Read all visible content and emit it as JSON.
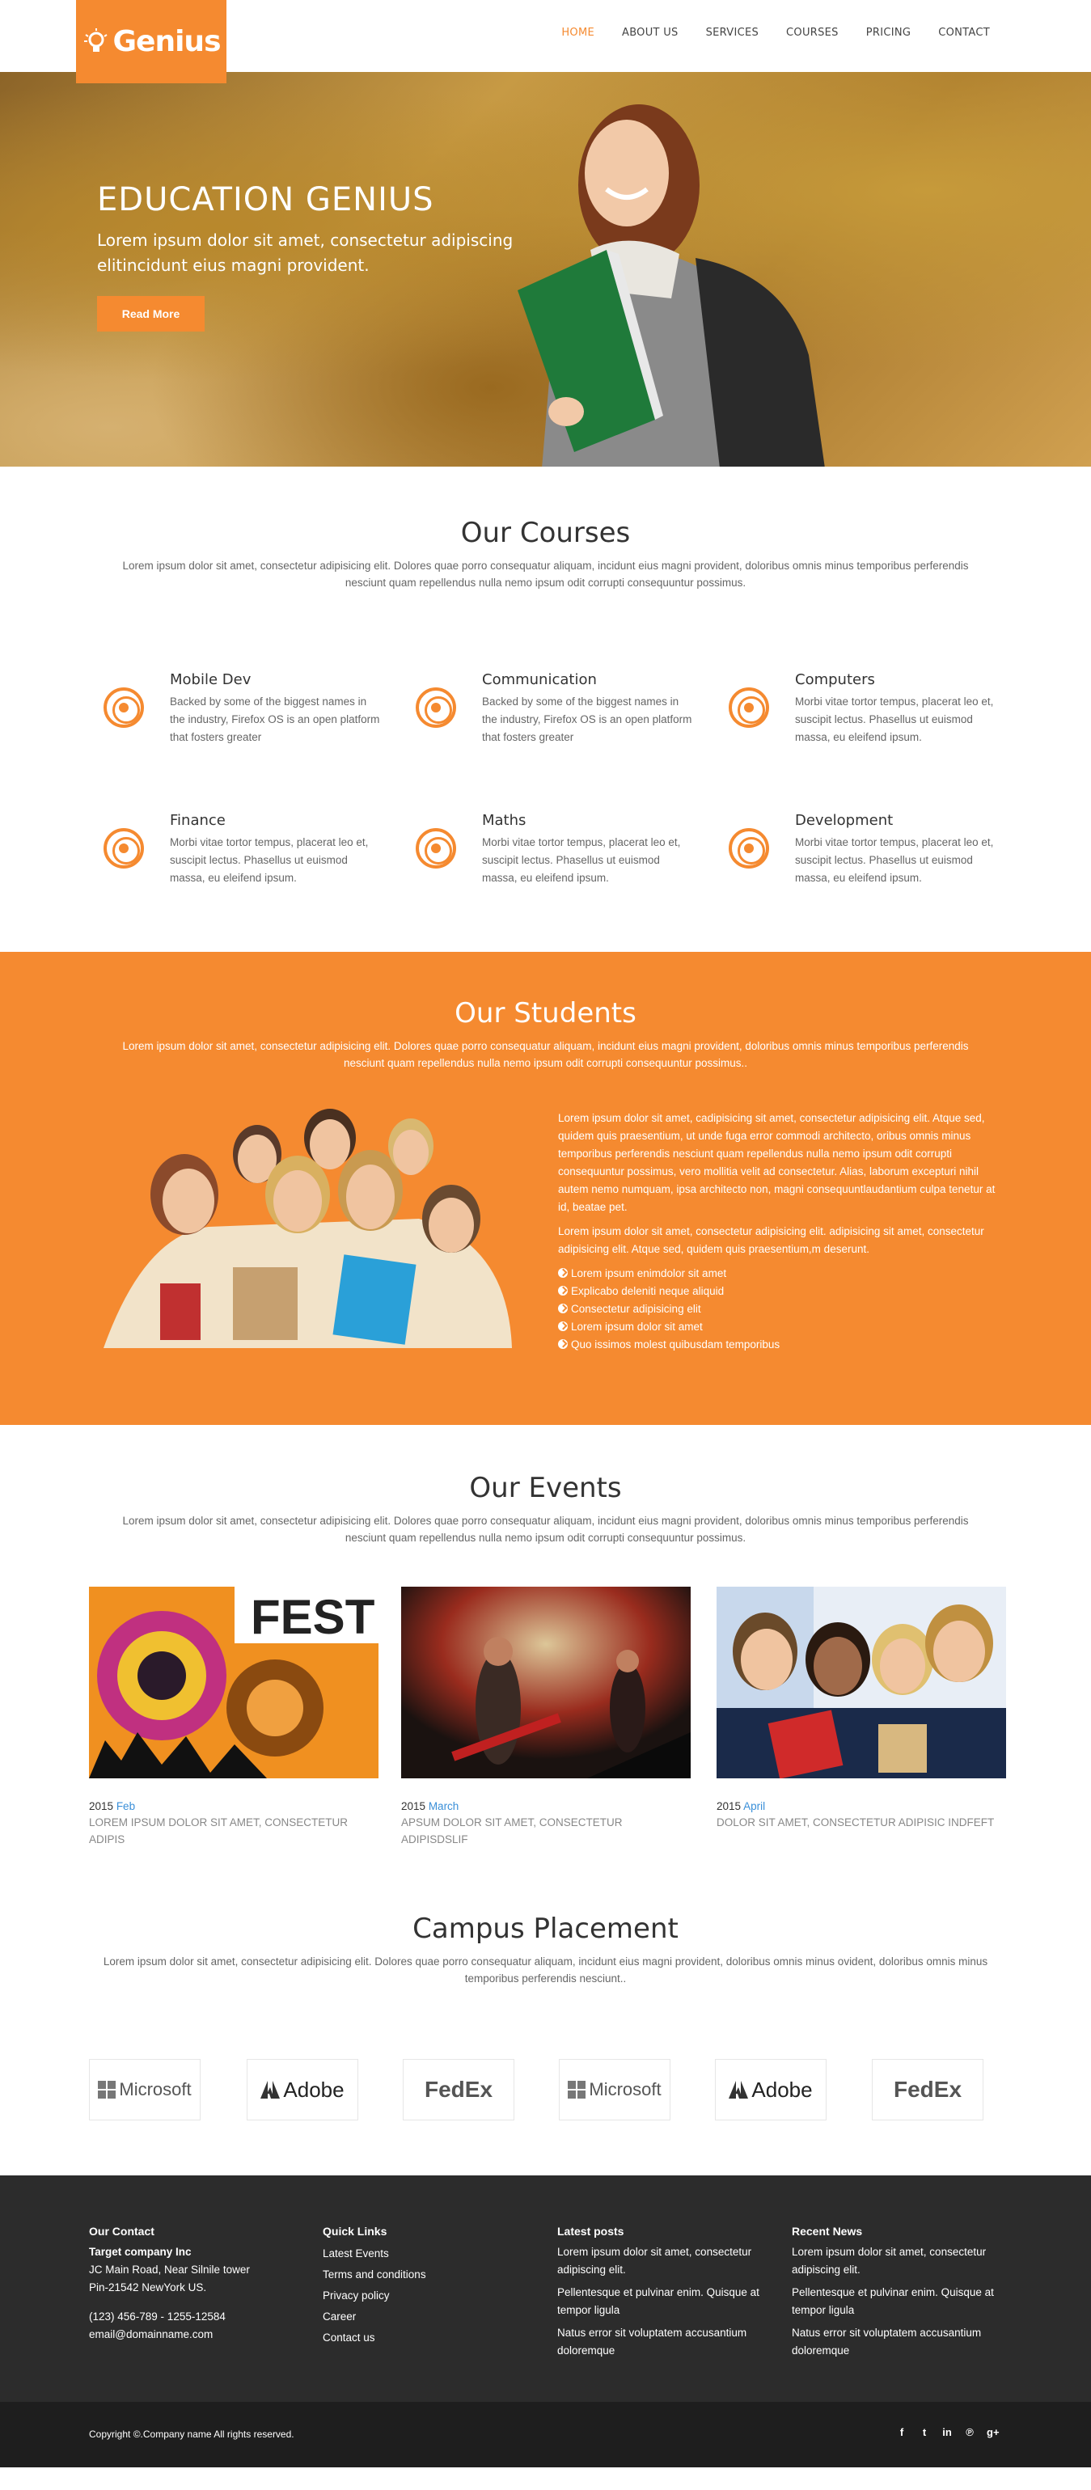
{
  "brand": {
    "name": "Genius",
    "color": "#f58a30"
  },
  "nav": {
    "items": [
      "HOME",
      "ABOUT US",
      "SERVICES",
      "COURSES",
      "PRICING",
      "CONTACT"
    ],
    "active": "HOME"
  },
  "hero": {
    "title": "EDUCATION GENIUS",
    "subtitle": "Lorem ipsum dolor sit amet, consectetur adipiscing elitincidunt eius magni provident.",
    "button": "Read More"
  },
  "courses": {
    "title": "Our Courses",
    "desc": "Lorem ipsum dolor sit amet, consectetur adipisicing elit. Dolores quae porro consequatur aliquam, incidunt eius magni provident, doloribus omnis minus temporibus perferendis nesciunt quam repellendus nulla nemo ipsum odit corrupti consequuntur possimus.",
    "items": [
      {
        "title": "Mobile Dev",
        "text": "Backed by some of the biggest names in the industry, Firefox OS is an open platform that fosters greater"
      },
      {
        "title": "Communication",
        "text": "Backed by some of the biggest names in the industry, Firefox OS is an open platform that fosters greater"
      },
      {
        "title": "Computers",
        "text": "Morbi vitae tortor tempus, placerat leo et, suscipit lectus. Phasellus ut euismod massa, eu eleifend ipsum."
      },
      {
        "title": "Finance",
        "text": "Morbi vitae tortor tempus, placerat leo et, suscipit lectus. Phasellus ut euismod massa, eu eleifend ipsum."
      },
      {
        "title": "Maths",
        "text": "Morbi vitae tortor tempus, placerat leo et, suscipit lectus. Phasellus ut euismod massa, eu eleifend ipsum."
      },
      {
        "title": "Development",
        "text": "Morbi vitae tortor tempus, placerat leo et, suscipit lectus. Phasellus ut euismod massa, eu eleifend ipsum."
      }
    ]
  },
  "students": {
    "title": "Our Students",
    "desc": "Lorem ipsum dolor sit amet, consectetur adipisicing elit. Dolores quae porro consequatur aliquam, incidunt eius magni provident, doloribus omnis minus temporibus perferendis nesciunt quam repellendus nulla nemo ipsum odit corrupti consequuntur possimus..",
    "para1": "Lorem ipsum dolor sit amet, cadipisicing sit amet, consectetur adipisicing elit. Atque sed, quidem quis praesentium, ut unde fuga error commodi architecto, oribus omnis minus temporibus perferendis nesciunt quam repellendus nulla nemo ipsum odit corrupti consequuntur possimus, vero mollitia velit ad consectetur. Alias, laborum excepturi nihil autem nemo numquam, ipsa architecto non, magni consequuntlaudantium culpa tenetur at id, beatae pet.",
    "para2": "Lorem ipsum dolor sit amet, consectetur adipisicing elit. adipisicing sit amet, consectetur adipisicing elit. Atque sed, quidem quis praesentium,m deserunt.",
    "list": [
      "Lorem ipsum enimdolor sit amet",
      "Explicabo deleniti neque aliquid",
      "Consectetur adipisicing elit",
      "Lorem ipsum dolor sit amet",
      "Quo issimos molest quibusdam temporibus"
    ]
  },
  "events": {
    "title": "Our Events",
    "desc": "Lorem ipsum dolor sit amet, consectetur adipisicing elit. Dolores quae porro consequatur aliquam, incidunt eius magni provident, doloribus omnis minus temporibus perferendis nesciunt quam repellendus nulla nemo ipsum odit corrupti consequuntur possimus.",
    "items": [
      {
        "year": "2015",
        "month": "Feb",
        "desc": "LOREM IPSUM DOLOR SIT AMET, CONSECTETUR ADIPIS",
        "img_text": "FEST"
      },
      {
        "year": "2015",
        "month": "March",
        "desc": "APSUM DOLOR SIT AMET, CONSECTETUR ADIPISDSLIF"
      },
      {
        "year": "2015",
        "month": "April",
        "desc": "DOLOR SIT AMET, CONSECTETUR ADIPISIC INDFEFT"
      }
    ]
  },
  "placement": {
    "title": "Campus Placement",
    "desc": "Lorem ipsum dolor sit amet, consectetur adipisicing elit. Dolores quae porro consequatur aliquam, incidunt eius magni provident, doloribus omnis minus ovident, doloribus omnis minus temporibus perferendis nesciunt..",
    "partners": [
      "Microsoft",
      "Adobe",
      "FedEx",
      "Microsoft",
      "Adobe",
      "FedEx"
    ]
  },
  "footer": {
    "contact": {
      "title": "Our Contact",
      "company": "Target company Inc",
      "address1": "JC Main Road, Near Silnile tower",
      "address2": "Pin-21542 NewYork US.",
      "phone": "(123) 456-789 - 1255-12584",
      "email": "email@domainname.com"
    },
    "links": {
      "title": "Quick Links",
      "items": [
        "Latest Events",
        "Terms and conditions",
        "Privacy policy",
        "Career",
        "Contact us"
      ]
    },
    "posts": {
      "title": "Latest posts",
      "items": [
        "Lorem ipsum dolor sit amet, consectetur adipiscing elit.",
        "Pellentesque et pulvinar enim. Quisque at tempor ligula",
        "Natus error sit voluptatem accusantium doloremque"
      ]
    },
    "news": {
      "title": "Recent News",
      "items": [
        "Lorem ipsum dolor sit amet, consectetur adipiscing elit.",
        "Pellentesque et pulvinar enim. Quisque at tempor ligula",
        "Natus error sit voluptatem accusantium doloremque"
      ]
    },
    "copyright": "Copyright ©.Company name All rights reserved.",
    "social": [
      "facebook-icon",
      "twitter-icon",
      "linkedin-icon",
      "pinterest-icon",
      "google-plus-icon"
    ]
  }
}
